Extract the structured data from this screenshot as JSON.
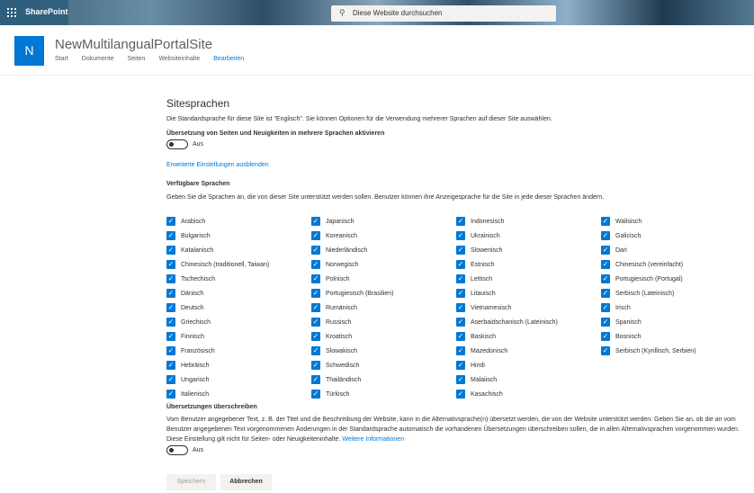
{
  "topbar": {
    "app_name": "SharePoint",
    "search_placeholder": "Diese Website durchsuchen"
  },
  "site": {
    "logo_letter": "N",
    "title": "NewMultilangualPortalSite",
    "nav": [
      "Start",
      "Dokumente",
      "Seiten",
      "Websiteinhalte",
      "Bearbeiten"
    ]
  },
  "page": {
    "title": "Sitesprachen",
    "description": "Die Standardsprache für diese Site ist \"Englisch\". Sie können Optionen für die Verwendung mehrerer Sprachen auf dieser Site auswählen.",
    "translation_label": "Übersetzung von Seiten und Neuigkeiten in mehrere Sprachen aktivieren",
    "translation_toggle": "Aus",
    "advanced_link": "Erweiterte Einstellungen ausblenden",
    "available_heading": "Verfügbare Sprachen",
    "available_desc": "Geben Sie die Sprachen an, die von dieser Site unterstützt werden sollen. Benutzer können ihre Anzeigesprache für die Site in jede dieser Sprachen ändern.",
    "override_heading": "Übersetzungen überschreiben",
    "override_desc": "Vom Benutzer angegebener Text, z. B. der Titel und die Beschreibung der Website, kann in die Alternativsprache(n) übersetzt werden, die von der Website unterstützt werden. Geben Sie an, ob die an vom Benutzer angegebenen Text vorgenommenen Änderungen in der Standardsprache automatisch die vorhandenen Übersetzungen überschreiben sollen, die in allen Alternativsprachen vorgenommen wurden. Diese Einstellung gilt nicht für Seiten- oder Neuigkeiteninhalte.",
    "more_info_link": "Weitere Informationen",
    "override_toggle": "Aus",
    "save_label": "Speichern",
    "cancel_label": "Abbrechen"
  },
  "languages": [
    [
      "Arabisch",
      "Bulgarisch",
      "Katalanisch",
      "Chinesisch (traditionell, Taiwan)",
      "Tschechisch",
      "Dänisch",
      "Deutsch",
      "Griechisch",
      "Finnisch",
      "Französisch",
      "Hebräisch",
      "Ungarisch",
      "Italienisch"
    ],
    [
      "Japanisch",
      "Koreanisch",
      "Niederländisch",
      "Norwegisch",
      "Polnisch",
      "Portugiesisch (Brasilien)",
      "Rumänisch",
      "Russisch",
      "Kroatisch",
      "Slowakisch",
      "Schwedisch",
      "Thailändisch",
      "Türkisch"
    ],
    [
      "Indonesisch",
      "Ukrainisch",
      "Slowenisch",
      "Estnisch",
      "Lettisch",
      "Litauisch",
      "Vietnamesisch",
      "Aserbaidschanisch (Lateinisch)",
      "Baskisch",
      "Mazedonisch",
      "Hindi",
      "Malaiisch",
      "Kasachisch"
    ],
    [
      "Walisisch",
      "Galicisch",
      "Dari",
      "Chinesisch (vereinfacht)",
      "Portugiesisch (Portugal)",
      "Serbisch (Lateinisch)",
      "Irisch",
      "Spanisch",
      "Bosnisch",
      "Serbisch (Kyrillisch, Serbien)"
    ]
  ]
}
